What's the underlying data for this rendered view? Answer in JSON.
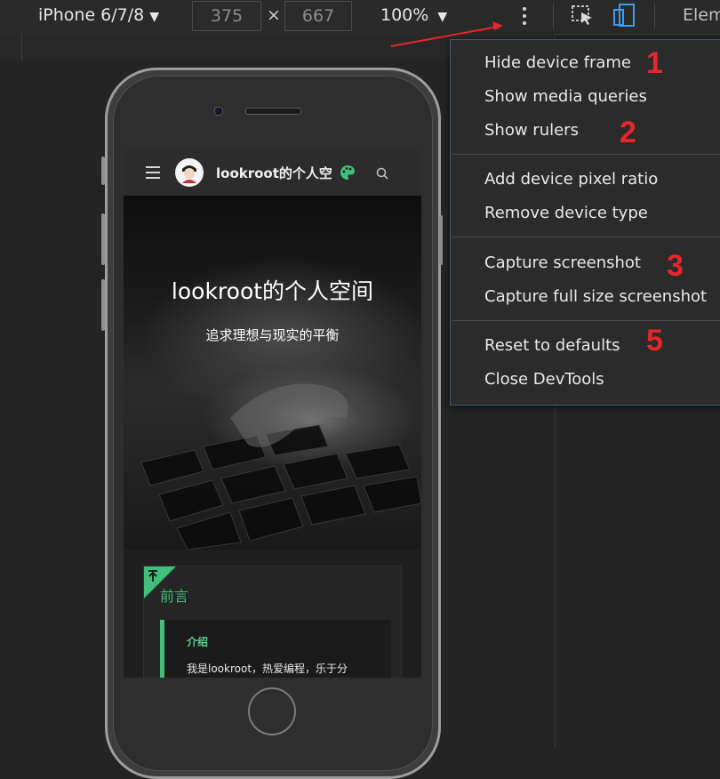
{
  "toolbar": {
    "device": "iPhone 6/7/8",
    "width": "375",
    "height": "667",
    "times": "×",
    "zoom": "100%",
    "caret": "▼",
    "elements_tab": "Elem"
  },
  "site": {
    "title": "lookroot的个人空",
    "hero_title": "lookroot的个人空间",
    "hero_subtitle": "追求理想与现实的平衡",
    "section_title": "前言",
    "intro_label": "介绍",
    "intro_text": "我是lookroot，热爱编程，乐于分",
    "accent": "#3fbf7a"
  },
  "menu": {
    "groups": [
      [
        "Hide device frame",
        "Show media queries",
        "Show rulers"
      ],
      [
        "Add device pixel ratio",
        "Remove device type"
      ],
      [
        "Capture screenshot",
        "Capture full size screenshot"
      ],
      [
        "Reset to defaults",
        "Close DevTools"
      ]
    ]
  },
  "annotations": [
    "1",
    "2",
    "3",
    "5"
  ],
  "annotation_color": "#e8262a",
  "icons": [
    "chevron-down-icon",
    "kebab-menu-icon",
    "inspect-element-icon",
    "device-toolbar-icon",
    "hamburger-icon",
    "avatar",
    "palette-icon",
    "search-icon",
    "back-to-top-icon"
  ]
}
